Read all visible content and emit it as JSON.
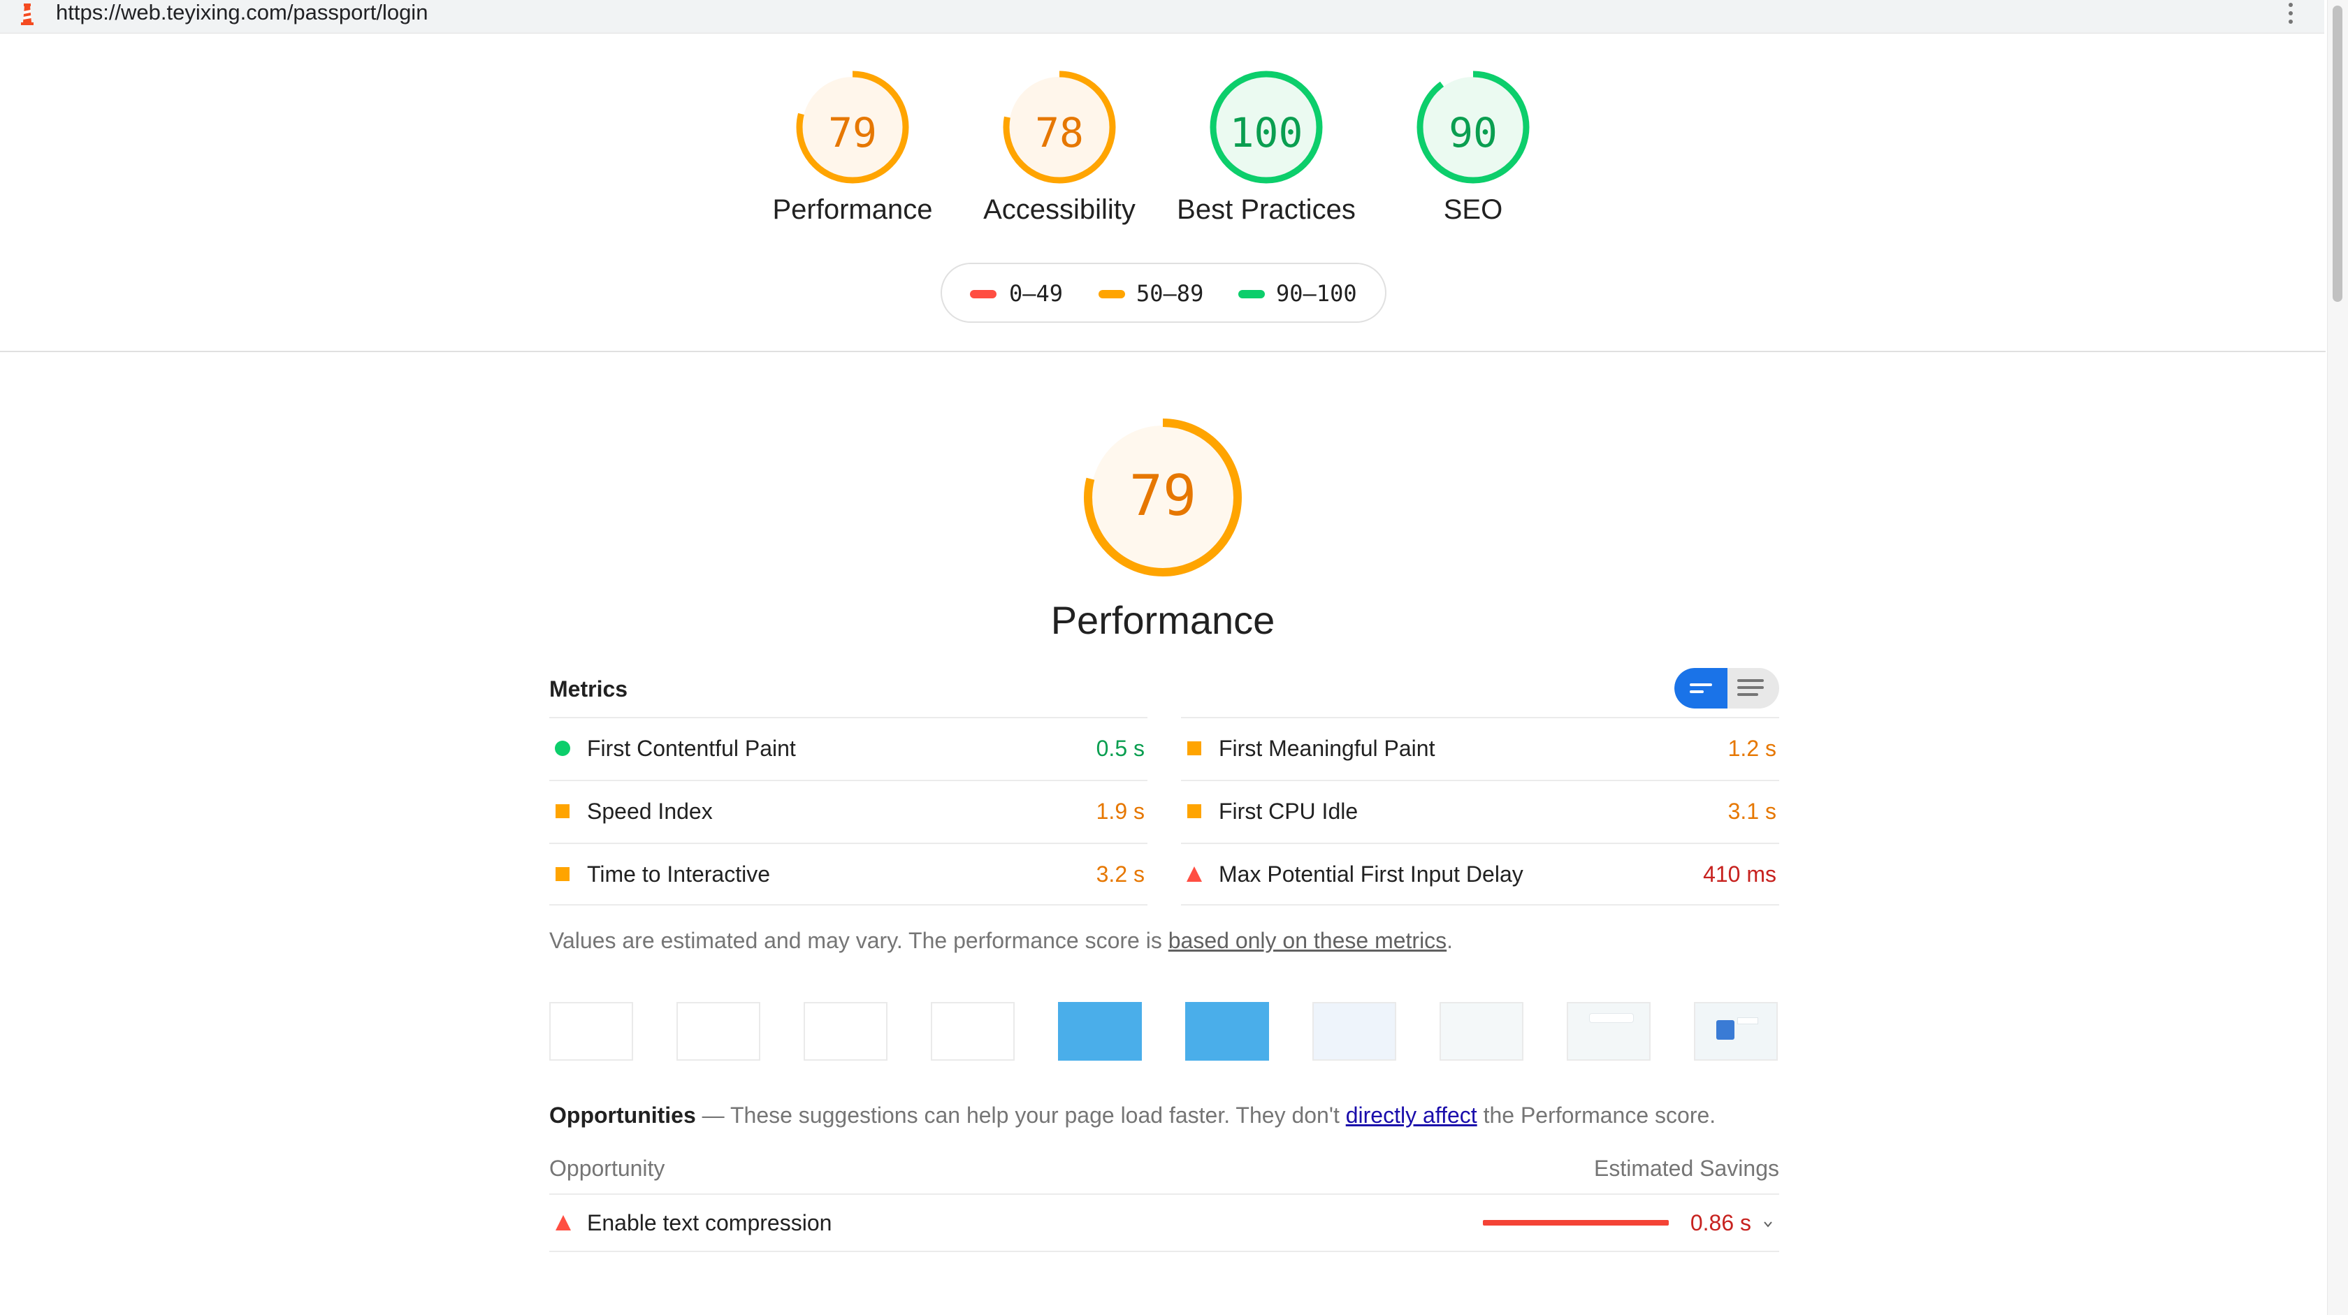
{
  "browser": {
    "url": "https://web.teyixing.com/passport/login",
    "logo_icon": "lighthouse-icon",
    "menu_icon": "kebab-menu-icon"
  },
  "colors": {
    "pass": "#0cce6b",
    "average": "#ffa400",
    "fail": "#ff4e42",
    "average_text": "#e67700",
    "pass_text": "#0a9e50",
    "fail_text": "#c7221f",
    "link": "#1a0dab",
    "toggle_active": "#1a73e8"
  },
  "categories": [
    {
      "label": "Performance",
      "score": "79",
      "score_value": 79,
      "rating": "average"
    },
    {
      "label": "Accessibility",
      "score": "78",
      "score_value": 78,
      "rating": "average"
    },
    {
      "label": "Best Practices",
      "score": "100",
      "score_value": 100,
      "rating": "pass"
    },
    {
      "label": "SEO",
      "score": "90",
      "score_value": 90,
      "rating": "pass"
    }
  ],
  "legend": [
    {
      "range": "0–49",
      "rating": "fail"
    },
    {
      "range": "50–89",
      "rating": "average"
    },
    {
      "range": "90–100",
      "rating": "pass"
    }
  ],
  "performance": {
    "score": "79",
    "score_value": 79,
    "title": "Performance",
    "metrics_header": "Metrics",
    "metrics": [
      {
        "label": "First Contentful Paint",
        "value": "0.5 s",
        "rating": "pass",
        "icon": "circle-pass-icon"
      },
      {
        "label": "First Meaningful Paint",
        "value": "1.2 s",
        "rating": "average",
        "icon": "square-average-icon"
      },
      {
        "label": "Speed Index",
        "value": "1.9 s",
        "rating": "average",
        "icon": "square-average-icon"
      },
      {
        "label": "First CPU Idle",
        "value": "3.1 s",
        "rating": "average",
        "icon": "square-average-icon"
      },
      {
        "label": "Time to Interactive",
        "value": "3.2 s",
        "rating": "average",
        "icon": "square-average-icon"
      },
      {
        "label": "Max Potential First Input Delay",
        "value": "410 ms",
        "rating": "fail",
        "icon": "triangle-fail-icon"
      }
    ],
    "note_prefix": "Values are estimated and may vary. The performance score is ",
    "note_link": "based only on these metrics",
    "note_suffix": ".",
    "filmstrip": [
      {
        "fill": "#ffffff"
      },
      {
        "fill": "#ffffff"
      },
      {
        "fill": "#ffffff"
      },
      {
        "fill": "#ffffff"
      },
      {
        "fill": "#4aaeea"
      },
      {
        "fill": "#4aaeea"
      },
      {
        "fill": "#eef4fb"
      },
      {
        "fill": "#f4f8f9"
      },
      {
        "fill": "#f3f7f8"
      },
      {
        "fill": "#f1f6f8"
      }
    ]
  },
  "opportunities": {
    "title": "Opportunities",
    "dash": " — ",
    "desc_prefix": "These suggestions can help your page load faster. They don't ",
    "desc_link": "directly affect",
    "desc_suffix": " the Performance score.",
    "col_opportunity": "Opportunity",
    "col_savings": "Estimated Savings",
    "items": [
      {
        "label": "Enable text compression",
        "value": "0.86 s",
        "rating": "fail",
        "savings_fraction": 1.0
      }
    ]
  }
}
